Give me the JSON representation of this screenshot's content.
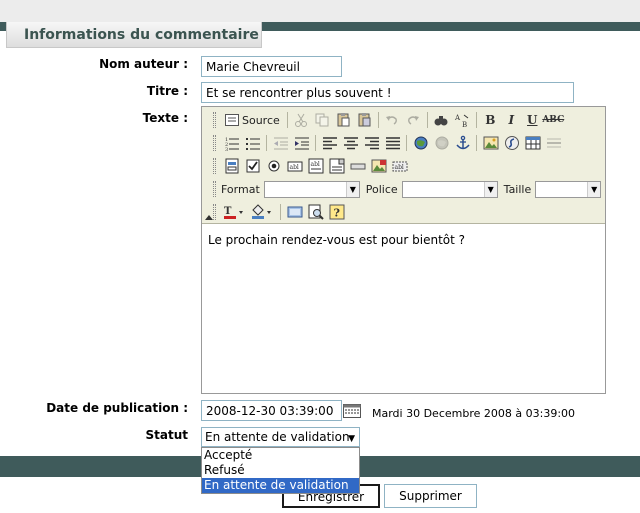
{
  "section": {
    "title": "Informations du commentaire"
  },
  "form": {
    "author_label": "Nom auteur :",
    "author_value": "Marie Chevreuil",
    "title_label": "Titre :",
    "title_value": "Et se rencontrer plus souvent !",
    "text_label": "Texte :",
    "pub_date_label": "Date de publication :",
    "pub_date_value": "2008-12-30 03:39:00",
    "pub_date_readout": "Mardi 30 Decembre 2008 à 03:39:00",
    "status_label": "Statut",
    "status_value": "En attente de validation"
  },
  "editor": {
    "source_label": "Source",
    "format_label": "Format",
    "font_label": "Police",
    "size_label": "Taille",
    "content": "Le prochain rendez-vous est pour bientôt ?",
    "icons": {
      "row1": [
        "source-icon",
        "cut-icon",
        "copy-icon",
        "paste-icon",
        "paste-word-icon",
        "undo-icon",
        "redo-icon",
        "find-icon",
        "replace-icon",
        "bold-icon",
        "italic-icon",
        "underline-icon",
        "strikethrough-icon"
      ],
      "row2": [
        "ordered-list-icon",
        "unordered-list-icon",
        "outdent-icon",
        "indent-icon",
        "align-left-icon",
        "align-center-icon",
        "align-right-icon",
        "justify-icon",
        "link-icon",
        "unlink-icon",
        "anchor-icon",
        "image-icon",
        "flash-icon",
        "table-icon",
        "horizontal-rule-icon"
      ],
      "row3": [
        "form-icon",
        "checkbox-icon",
        "radio-icon",
        "textfield-icon",
        "textarea-icon",
        "select-icon",
        "button-icon",
        "image-button-icon",
        "hidden-field-icon"
      ],
      "row5": [
        "text-color-icon",
        "background-color-icon",
        "show-blocks-icon",
        "preview-icon",
        "about-icon"
      ]
    }
  },
  "dropdown": {
    "options": [
      "Accepté",
      "Refusé",
      "En attente de validation"
    ],
    "selected_index": 2
  },
  "buttons": {
    "save_label": "Enregistrer",
    "delete_label": "Supprimer"
  },
  "colors": {
    "header_bar": "#3f5b5b",
    "section_title": "#3b5450",
    "input_border": "#8fb3c4",
    "toolbar_bg": "#efefde",
    "selection": "#3169c6"
  }
}
